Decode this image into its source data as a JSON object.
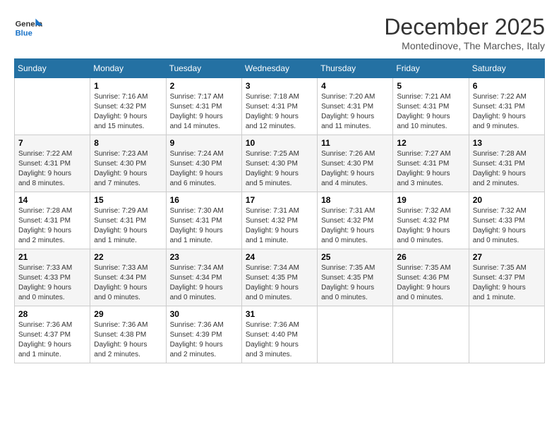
{
  "header": {
    "logo_general": "General",
    "logo_blue": "Blue",
    "month_title": "December 2025",
    "location": "Montedinove, The Marches, Italy"
  },
  "calendar": {
    "weekdays": [
      "Sunday",
      "Monday",
      "Tuesday",
      "Wednesday",
      "Thursday",
      "Friday",
      "Saturday"
    ],
    "weeks": [
      [
        {
          "day": "",
          "info": ""
        },
        {
          "day": "1",
          "info": "Sunrise: 7:16 AM\nSunset: 4:32 PM\nDaylight: 9 hours\nand 15 minutes."
        },
        {
          "day": "2",
          "info": "Sunrise: 7:17 AM\nSunset: 4:31 PM\nDaylight: 9 hours\nand 14 minutes."
        },
        {
          "day": "3",
          "info": "Sunrise: 7:18 AM\nSunset: 4:31 PM\nDaylight: 9 hours\nand 12 minutes."
        },
        {
          "day": "4",
          "info": "Sunrise: 7:20 AM\nSunset: 4:31 PM\nDaylight: 9 hours\nand 11 minutes."
        },
        {
          "day": "5",
          "info": "Sunrise: 7:21 AM\nSunset: 4:31 PM\nDaylight: 9 hours\nand 10 minutes."
        },
        {
          "day": "6",
          "info": "Sunrise: 7:22 AM\nSunset: 4:31 PM\nDaylight: 9 hours\nand 9 minutes."
        }
      ],
      [
        {
          "day": "7",
          "info": "Sunrise: 7:22 AM\nSunset: 4:31 PM\nDaylight: 9 hours\nand 8 minutes."
        },
        {
          "day": "8",
          "info": "Sunrise: 7:23 AM\nSunset: 4:30 PM\nDaylight: 9 hours\nand 7 minutes."
        },
        {
          "day": "9",
          "info": "Sunrise: 7:24 AM\nSunset: 4:30 PM\nDaylight: 9 hours\nand 6 minutes."
        },
        {
          "day": "10",
          "info": "Sunrise: 7:25 AM\nSunset: 4:30 PM\nDaylight: 9 hours\nand 5 minutes."
        },
        {
          "day": "11",
          "info": "Sunrise: 7:26 AM\nSunset: 4:30 PM\nDaylight: 9 hours\nand 4 minutes."
        },
        {
          "day": "12",
          "info": "Sunrise: 7:27 AM\nSunset: 4:31 PM\nDaylight: 9 hours\nand 3 minutes."
        },
        {
          "day": "13",
          "info": "Sunrise: 7:28 AM\nSunset: 4:31 PM\nDaylight: 9 hours\nand 2 minutes."
        }
      ],
      [
        {
          "day": "14",
          "info": "Sunrise: 7:28 AM\nSunset: 4:31 PM\nDaylight: 9 hours\nand 2 minutes."
        },
        {
          "day": "15",
          "info": "Sunrise: 7:29 AM\nSunset: 4:31 PM\nDaylight: 9 hours\nand 1 minute."
        },
        {
          "day": "16",
          "info": "Sunrise: 7:30 AM\nSunset: 4:31 PM\nDaylight: 9 hours\nand 1 minute."
        },
        {
          "day": "17",
          "info": "Sunrise: 7:31 AM\nSunset: 4:32 PM\nDaylight: 9 hours\nand 1 minute."
        },
        {
          "day": "18",
          "info": "Sunrise: 7:31 AM\nSunset: 4:32 PM\nDaylight: 9 hours\nand 0 minutes."
        },
        {
          "day": "19",
          "info": "Sunrise: 7:32 AM\nSunset: 4:32 PM\nDaylight: 9 hours\nand 0 minutes."
        },
        {
          "day": "20",
          "info": "Sunrise: 7:32 AM\nSunset: 4:33 PM\nDaylight: 9 hours\nand 0 minutes."
        }
      ],
      [
        {
          "day": "21",
          "info": "Sunrise: 7:33 AM\nSunset: 4:33 PM\nDaylight: 9 hours\nand 0 minutes."
        },
        {
          "day": "22",
          "info": "Sunrise: 7:33 AM\nSunset: 4:34 PM\nDaylight: 9 hours\nand 0 minutes."
        },
        {
          "day": "23",
          "info": "Sunrise: 7:34 AM\nSunset: 4:34 PM\nDaylight: 9 hours\nand 0 minutes."
        },
        {
          "day": "24",
          "info": "Sunrise: 7:34 AM\nSunset: 4:35 PM\nDaylight: 9 hours\nand 0 minutes."
        },
        {
          "day": "25",
          "info": "Sunrise: 7:35 AM\nSunset: 4:35 PM\nDaylight: 9 hours\nand 0 minutes."
        },
        {
          "day": "26",
          "info": "Sunrise: 7:35 AM\nSunset: 4:36 PM\nDaylight: 9 hours\nand 0 minutes."
        },
        {
          "day": "27",
          "info": "Sunrise: 7:35 AM\nSunset: 4:37 PM\nDaylight: 9 hours\nand 1 minute."
        }
      ],
      [
        {
          "day": "28",
          "info": "Sunrise: 7:36 AM\nSunset: 4:37 PM\nDaylight: 9 hours\nand 1 minute."
        },
        {
          "day": "29",
          "info": "Sunrise: 7:36 AM\nSunset: 4:38 PM\nDaylight: 9 hours\nand 2 minutes."
        },
        {
          "day": "30",
          "info": "Sunrise: 7:36 AM\nSunset: 4:39 PM\nDaylight: 9 hours\nand 2 minutes."
        },
        {
          "day": "31",
          "info": "Sunrise: 7:36 AM\nSunset: 4:40 PM\nDaylight: 9 hours\nand 3 minutes."
        },
        {
          "day": "",
          "info": ""
        },
        {
          "day": "",
          "info": ""
        },
        {
          "day": "",
          "info": ""
        }
      ]
    ]
  }
}
